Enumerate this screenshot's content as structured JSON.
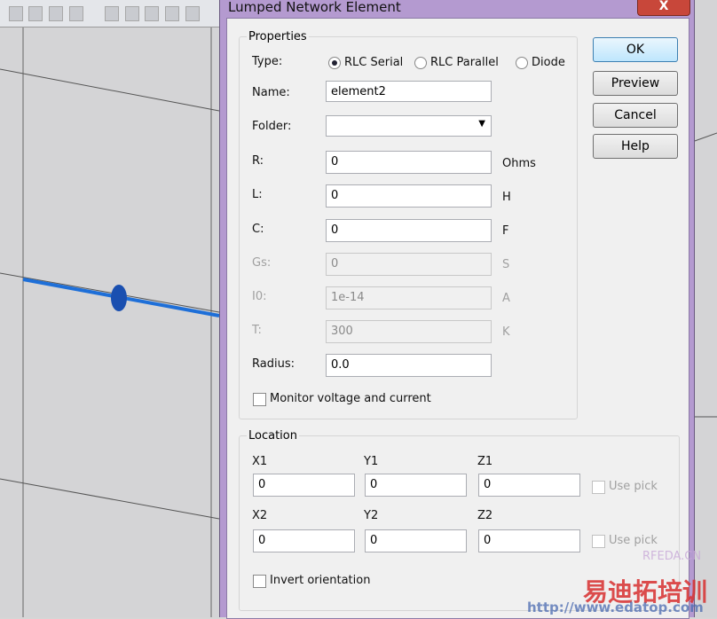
{
  "toolbar": {
    "icons": [
      "e-field-icon",
      "i-icon",
      "h-icon",
      "n-icon",
      "re-icon",
      "im-icon",
      "abs-icon",
      "db-icon",
      "phase-icon"
    ]
  },
  "dialog": {
    "title": "Lumped Network Element",
    "close_label": "X",
    "properties": {
      "group_label": "Properties",
      "type_label": "Type:",
      "type_options": [
        {
          "label": "RLC Serial",
          "selected": true
        },
        {
          "label": "RLC Parallel",
          "selected": false
        },
        {
          "label": "Diode",
          "selected": false
        }
      ],
      "name_label": "Name:",
      "name_value": "element2",
      "folder_label": "Folder:",
      "folder_value": "",
      "r_label": "R:",
      "r_value": "0",
      "r_unit": "Ohms",
      "l_label": "L:",
      "l_value": "0",
      "l_unit": "H",
      "c_label": "C:",
      "c_value": "0",
      "c_unit": "F",
      "gs_label": "Gs:",
      "gs_value": "0",
      "gs_unit": "S",
      "i0_label": "I0:",
      "i0_value": "1e-14",
      "i0_unit": "A",
      "t_label": "T:",
      "t_value": "300",
      "t_unit": "K",
      "radius_label": "Radius:",
      "radius_value": "0.0",
      "monitor_label": "Monitor voltage and current"
    },
    "location": {
      "group_label": "Location",
      "x1_label": "X1",
      "x1_value": "0",
      "y1_label": "Y1",
      "y1_value": "0",
      "z1_label": "Z1",
      "z1_value": "0",
      "x2_label": "X2",
      "x2_value": "0",
      "y2_label": "Y2",
      "y2_value": "0",
      "z2_label": "Z2",
      "z2_value": "0",
      "use_pick_label": "Use pick",
      "invert_label": "Invert orientation"
    },
    "buttons": {
      "ok": "OK",
      "preview": "Preview",
      "cancel": "Cancel",
      "help": "Help"
    }
  },
  "watermark": {
    "site": "RFEDA.CN",
    "brand": "易迪拓培训",
    "url": "http://www.edatop.com"
  }
}
